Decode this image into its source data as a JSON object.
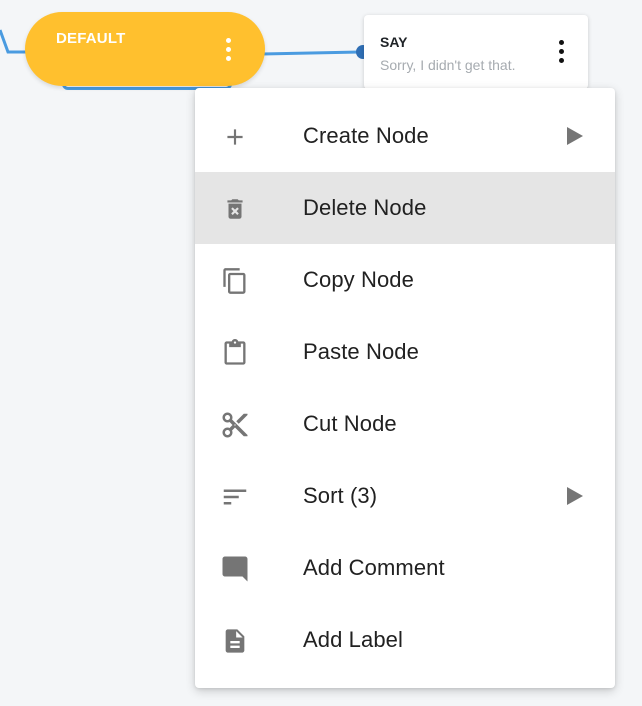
{
  "colors": {
    "canvas_background": "#f4f6f8",
    "default_node": "#ffc02e",
    "connector": "#4a9be0",
    "port": "#2f6fb5",
    "menu_highlight": "#e5e5e5",
    "icon_gray": "#757575"
  },
  "canvas": {
    "default_node": {
      "title": "DEFAULT",
      "menu_icon": "more-vertical-icon"
    },
    "say_node": {
      "title": "SAY",
      "text": "Sorry, I didn't get that.",
      "menu_icon": "more-vertical-icon"
    }
  },
  "context_menu": {
    "items": [
      {
        "label": "Create Node",
        "icon": "plus-icon",
        "has_submenu": true,
        "highlighted": false
      },
      {
        "label": "Delete Node",
        "icon": "delete-icon",
        "has_submenu": false,
        "highlighted": true
      },
      {
        "label": "Copy Node",
        "icon": "copy-icon",
        "has_submenu": false,
        "highlighted": false
      },
      {
        "label": "Paste Node",
        "icon": "clipboard-icon",
        "has_submenu": false,
        "highlighted": false
      },
      {
        "label": "Cut Node",
        "icon": "scissors-icon",
        "has_submenu": false,
        "highlighted": false
      },
      {
        "label": "Sort (3)",
        "icon": "sort-icon",
        "has_submenu": true,
        "highlighted": false
      },
      {
        "label": "Add Comment",
        "icon": "comment-icon",
        "has_submenu": false,
        "highlighted": false
      },
      {
        "label": "Add Label",
        "icon": "label-file-icon",
        "has_submenu": false,
        "highlighted": false
      }
    ]
  }
}
